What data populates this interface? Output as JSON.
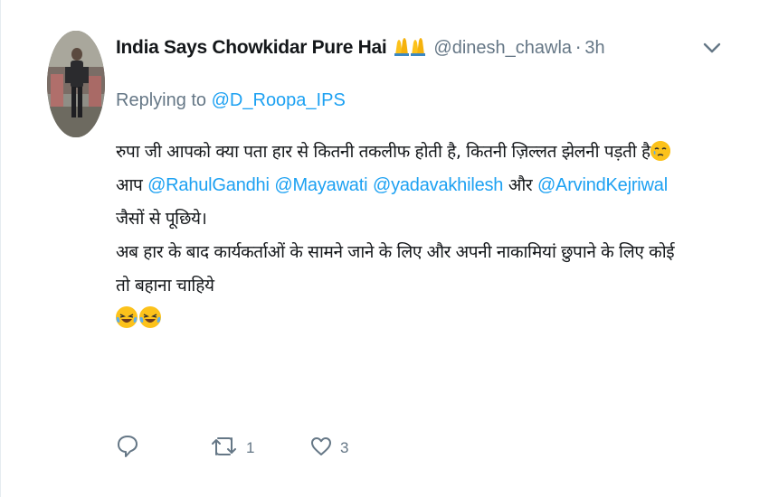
{
  "tweet": {
    "author": {
      "display_name": "India Says Chowkidar Pure Hai",
      "name_emoji": "🙏🙏",
      "handle": "@dinesh_chawla",
      "separator": "·",
      "time": "3h"
    },
    "reply": {
      "prefix": "Replying to",
      "to": "@D_Roopa_IPS"
    },
    "body": {
      "line1": "रुपा जी आपको क्या पता हार से कितनी तकलीफ होती है, कितनी ज़िल्लत झेलनी पड़ती है",
      "line2_prefix": "आप",
      "mentions": [
        "@RahulGandhi",
        "@Mayawati",
        "@yadavakhilesh",
        "@ArvindKejriwal"
      ],
      "and_word": "और",
      "line3": "जैसों से पूछिये।",
      "line4": "अब हार के बाद कार्यकर्ताओं के सामने जाने के लिए और अपनी नाकामियां छुपाने के लिए कोई",
      "line5": "तो बहाना चाहिये"
    },
    "actions": {
      "reply_count": "",
      "retweet_count": "1",
      "like_count": "3"
    },
    "icons": {
      "caret": "chevron-down-icon",
      "reply": "reply-icon",
      "retweet": "retweet-icon",
      "like": "heart-icon"
    },
    "colors": {
      "link": "#1da1f2",
      "muted": "#657786",
      "text": "#14171a",
      "emoji": "#fcc21b"
    }
  }
}
